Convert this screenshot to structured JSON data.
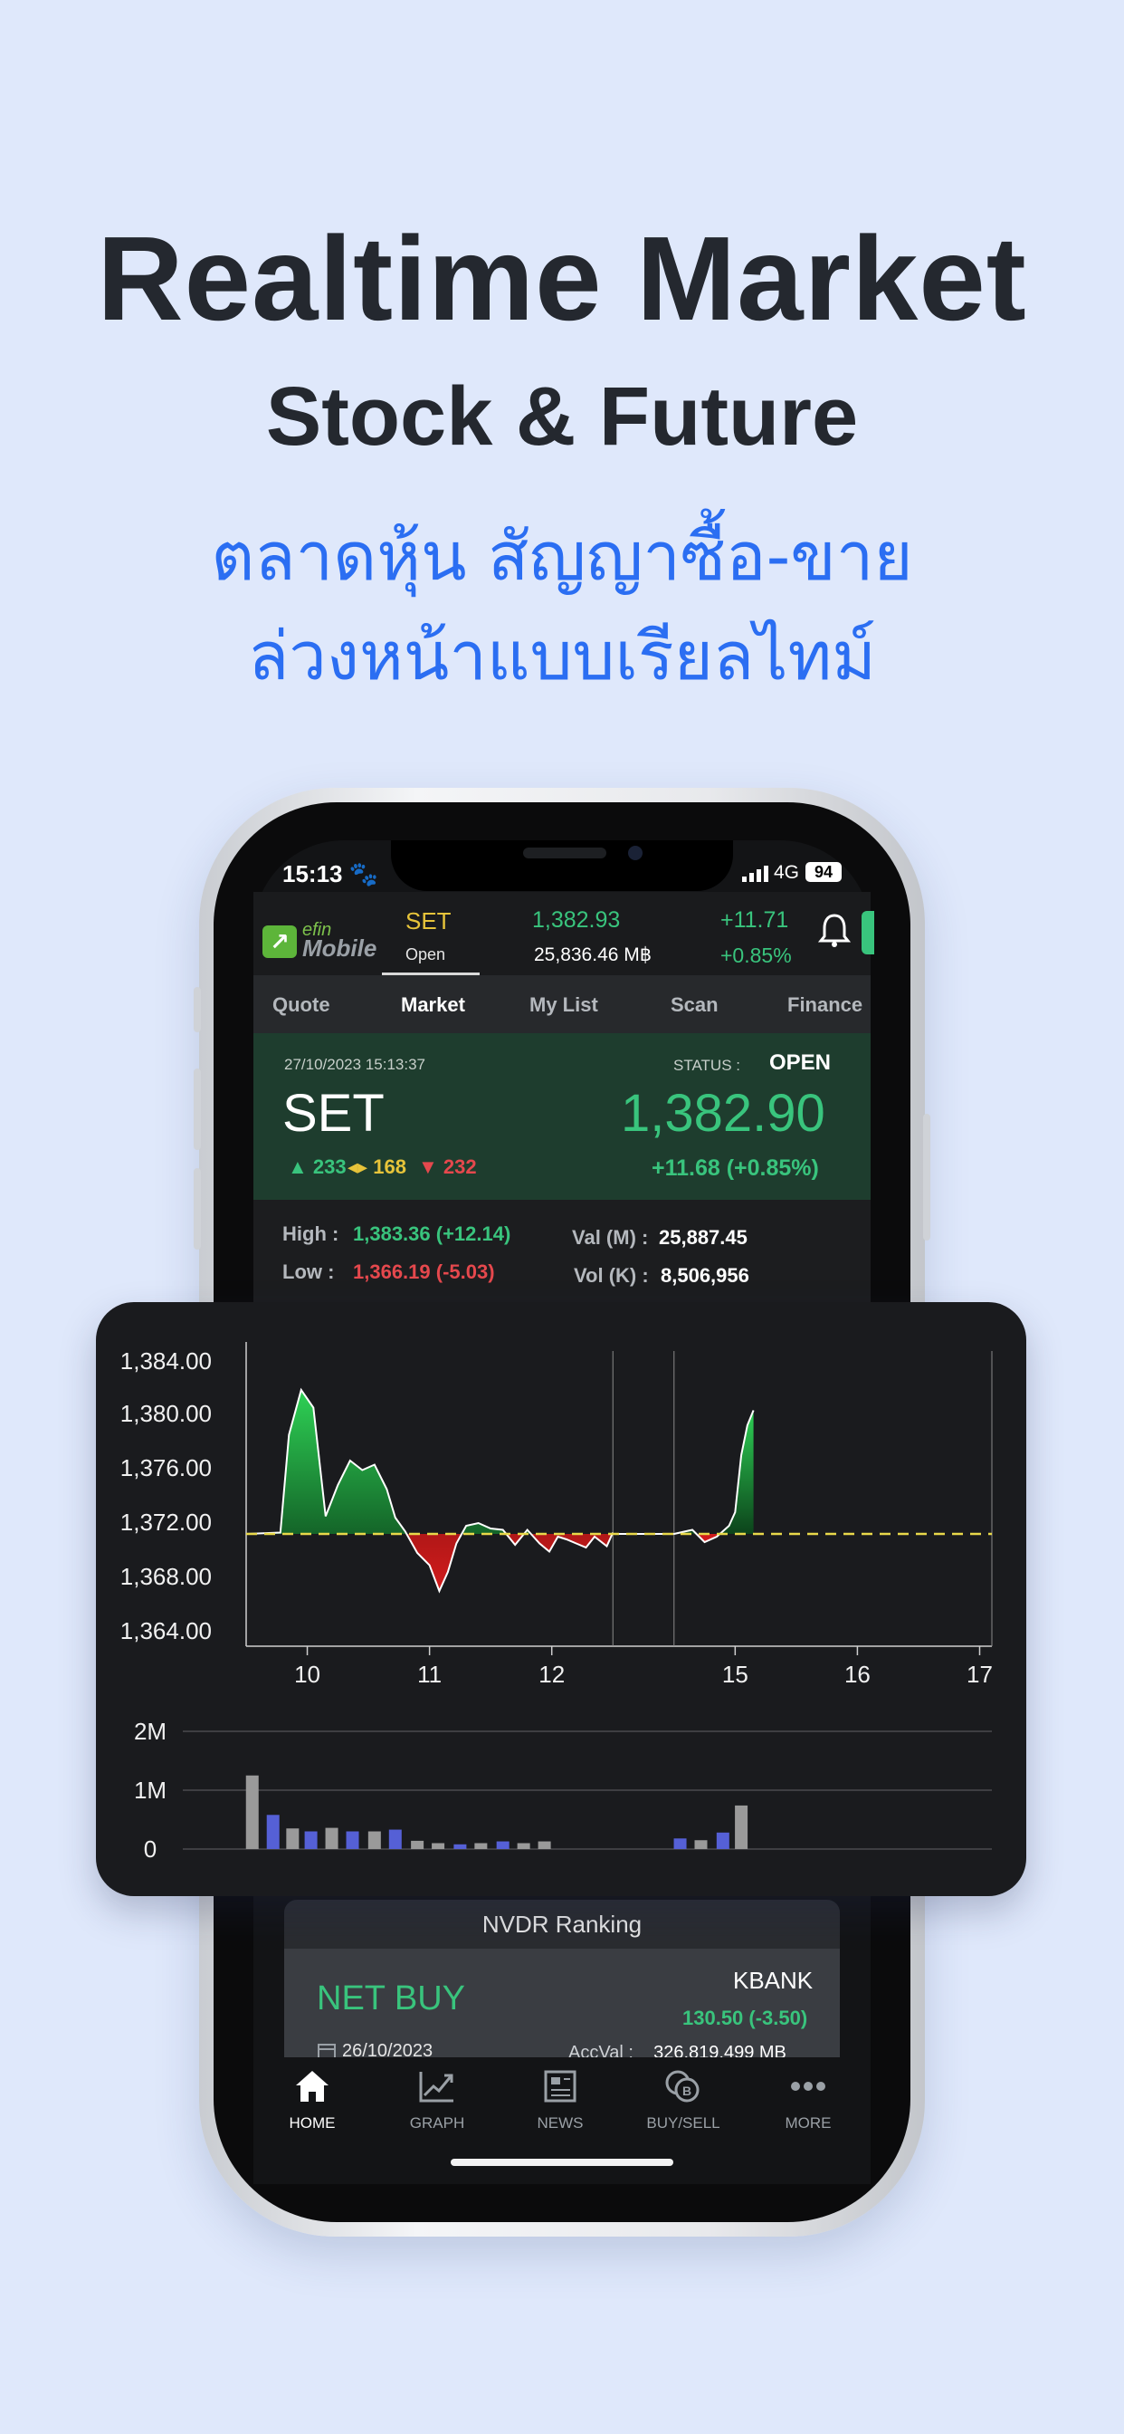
{
  "promo": {
    "title": "Realtime Market",
    "subtitle": "Stock & Future",
    "thai_line1": "ตลาดหุ้น สัญญาซื้อ-ขาย",
    "thai_line2": "ล่วงหน้าแบบเรียลไทม์"
  },
  "status_bar": {
    "time": "15:13",
    "network": "4G",
    "battery": "94"
  },
  "app": {
    "logo_top": "efin",
    "logo_bottom": "Mobile"
  },
  "ticker": {
    "symbol": "SET",
    "state": "Open",
    "price": "1,382.93",
    "value": "25,836.46 M฿",
    "change": "+11.71",
    "percent": "+0.85%"
  },
  "tabs": [
    "Quote",
    "Market",
    "My List",
    "Scan",
    "Finance"
  ],
  "active_tab": "Market",
  "set_panel": {
    "datetime": "27/10/2023 15:13:37",
    "status_label": "STATUS :",
    "status": "OPEN",
    "name": "SET",
    "index": "1,382.90",
    "advance": "233",
    "unchanged": "168",
    "decline": "232",
    "change": "+11.68 (+0.85%)"
  },
  "stats": {
    "high_label": "High :",
    "high_value": "1,383.36 (+12.14)",
    "low_label": "Low :",
    "low_value": "1,366.19 (-5.03)",
    "val_label": "Val (M) :",
    "val_value": "25,887.45",
    "vol_label": "Vol (K) :",
    "vol_value": "8,506,956"
  },
  "chart_data": {
    "type": "area",
    "baseline": 1371.2,
    "y_ticks": [
      "1,384.00",
      "1,380.00",
      "1,376.00",
      "1,372.00",
      "1,368.00",
      "1,364.00"
    ],
    "ylim": [
      1364,
      1384
    ],
    "x_ticks": [
      "10",
      "11",
      "12",
      "15",
      "16",
      "17"
    ],
    "colors": {
      "up": "#1f8a3b",
      "down": "#c4161c",
      "baseline": "#e8d84a"
    },
    "session1": {
      "x": [
        9.5,
        9.78,
        9.85,
        9.95,
        10.05,
        10.15,
        10.25,
        10.35,
        10.45,
        10.55,
        10.65,
        10.72,
        10.8,
        10.9,
        11.0,
        11.08,
        11.15,
        11.22,
        11.3,
        11.4,
        11.5,
        11.6,
        11.7,
        11.8,
        11.9,
        11.98,
        12.05,
        12.12,
        12.2,
        12.28,
        12.35,
        12.45,
        12.5
      ],
      "y": [
        1371.2,
        1371.3,
        1378.5,
        1381.8,
        1380.5,
        1372.5,
        1374.8,
        1376.6,
        1375.9,
        1376.3,
        1374.5,
        1372.4,
        1371.4,
        1369.8,
        1368.9,
        1367.0,
        1368.4,
        1370.5,
        1371.8,
        1372.0,
        1371.6,
        1371.5,
        1370.4,
        1371.5,
        1370.5,
        1369.9,
        1371.0,
        1370.8,
        1370.5,
        1370.2,
        1371.0,
        1370.3,
        1371.3
      ]
    },
    "session2": {
      "x": [
        14.5,
        14.65,
        14.75,
        14.85,
        14.95,
        15.0,
        15.05,
        15.1,
        15.15
      ],
      "y": [
        1371.2,
        1371.5,
        1370.6,
        1371.0,
        1371.8,
        1372.8,
        1377.0,
        1379.2,
        1380.3
      ]
    },
    "volume": {
      "y_ticks": [
        "2M",
        "1M",
        "0"
      ],
      "ylim": [
        0,
        2
      ],
      "bars_x": [
        9.55,
        9.72,
        9.88,
        10.03,
        10.2,
        10.37,
        10.55,
        10.72,
        10.9,
        11.07,
        11.25,
        11.42,
        11.6,
        11.77,
        11.94,
        14.55,
        14.72,
        14.9,
        15.05
      ],
      "bars_y": [
        1.25,
        0.58,
        0.35,
        0.3,
        0.36,
        0.3,
        0.3,
        0.33,
        0.14,
        0.1,
        0.08,
        0.1,
        0.13,
        0.1,
        0.13,
        0.18,
        0.15,
        0.28,
        0.74
      ],
      "bars_color": [
        "#9a9a9a",
        "#5560d6",
        "#9a9a9a",
        "#5560d6",
        "#9a9a9a",
        "#5560d6",
        "#9a9a9a",
        "#5560d6",
        "#9a9a9a",
        "#9a9a9a",
        "#5560d6",
        "#9a9a9a",
        "#5560d6",
        "#9a9a9a",
        "#9a9a9a",
        "#5560d6",
        "#9a9a9a",
        "#5560d6",
        "#9a9a9a"
      ]
    }
  },
  "nvdr": {
    "title": "NVDR Ranking",
    "net_label": "NET BUY",
    "symbol": "KBANK",
    "price": "130.50 (-3.50)",
    "date": "26/10/2023",
    "acc_label": "AccVal :",
    "acc_value": "326,819,499 MB"
  },
  "nav": [
    "HOME",
    "GRAPH",
    "NEWS",
    "BUY/SELL",
    "MORE"
  ]
}
